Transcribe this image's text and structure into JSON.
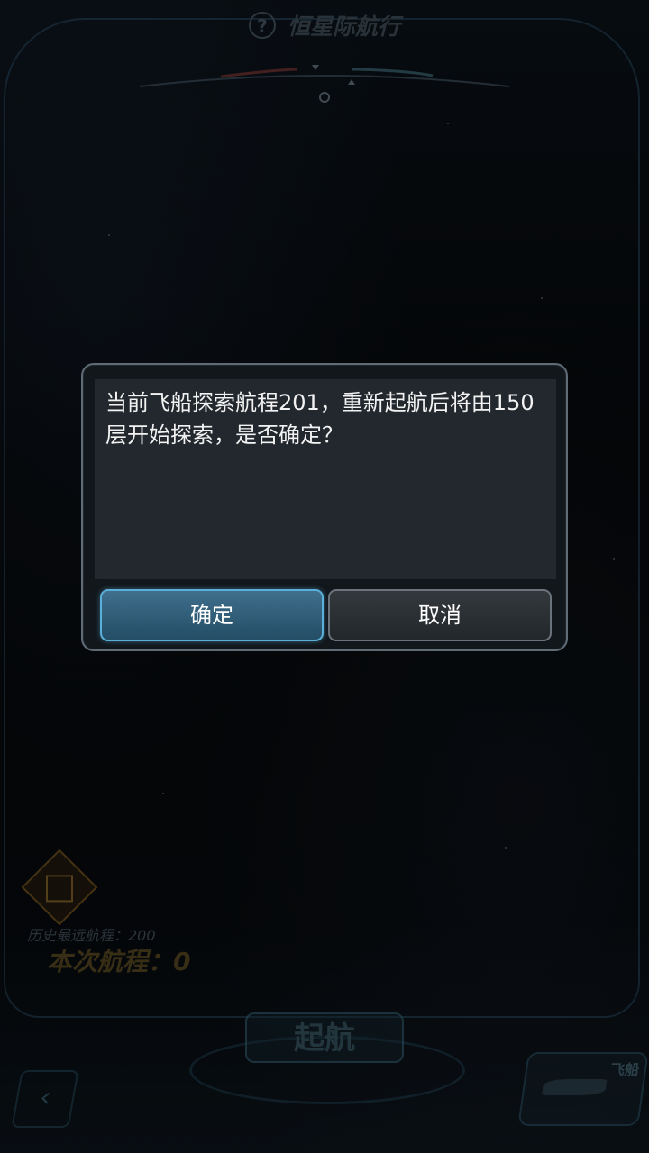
{
  "header": {
    "title": "恒星际航行",
    "help_icon": "question-mark-icon"
  },
  "stats": {
    "history_label": "历史最远航程：200",
    "current_label": "本次航程：",
    "current_value": "0"
  },
  "launch_button": "起航",
  "ship_button_label": "飞船",
  "dialog": {
    "message": "当前飞船探索航程201，重新起航后将由150层开始探索，是否确定？",
    "confirm_label": "确定",
    "cancel_label": "取消"
  },
  "colors": {
    "accent": "#5ab0d8",
    "dialog_bg": "#23282e",
    "text": "#f2f2f2"
  }
}
